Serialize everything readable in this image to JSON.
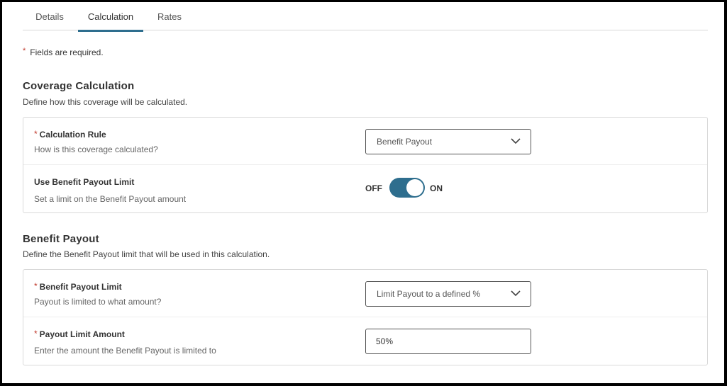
{
  "tabs": [
    {
      "label": "Details",
      "active": false
    },
    {
      "label": "Calculation",
      "active": true
    },
    {
      "label": "Rates",
      "active": false
    }
  ],
  "required_note": {
    "star": "*",
    "text": "Fields are required."
  },
  "coverage": {
    "title": "Coverage Calculation",
    "description": "Define how this coverage will be calculated.",
    "calculation_rule": {
      "star": "*",
      "label": "Calculation Rule",
      "help": "How is this coverage calculated?",
      "value": "Benefit Payout",
      "icon": "chevron-down-icon"
    },
    "use_limit": {
      "label": "Use Benefit Payout Limit",
      "help": "Set a limit on the Benefit Payout amount",
      "off_label": "OFF",
      "on_label": "ON",
      "state": "on"
    }
  },
  "benefit_payout": {
    "title": "Benefit Payout",
    "description": "Define the Benefit Payout limit that will be used in this calculation.",
    "limit": {
      "star": "*",
      "label": "Benefit Payout Limit",
      "help": "Payout is limited to what amount?",
      "value": "Limit Payout to a defined %",
      "icon": "chevron-down-icon"
    },
    "amount": {
      "star": "*",
      "label": "Payout Limit Amount",
      "help": "Enter the amount the Benefit Payout is limited to",
      "value": "50%"
    }
  },
  "colors": {
    "accent": "#2e6e8e",
    "required": "#c0392b",
    "border": "#d9d9d9"
  }
}
